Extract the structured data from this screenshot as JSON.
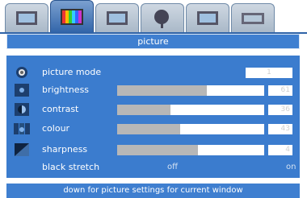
{
  "tabs": [
    {
      "icon": "tv-icon",
      "active": false
    },
    {
      "icon": "picture-tv-icon",
      "active": true
    },
    {
      "icon": "tv-sound-icon",
      "active": false
    },
    {
      "icon": "satellite-dish-icon",
      "active": false
    },
    {
      "icon": "tv-settings-icon",
      "active": false
    },
    {
      "icon": "tv-install-icon",
      "active": false
    }
  ],
  "title": "picture",
  "rows": {
    "picture_mode": {
      "label": "picture mode",
      "value": "1",
      "icon": "picture-mode-icon"
    },
    "brightness": {
      "label": "brightness",
      "value": "61",
      "level": 61,
      "icon": "brightness-icon"
    },
    "contrast": {
      "label": "contrast",
      "value": "36",
      "level": 36,
      "icon": "contrast-icon"
    },
    "colour": {
      "label": "colour",
      "value": "43",
      "level": 43,
      "icon": "colour-icon"
    },
    "sharpness": {
      "label": "sharpness",
      "value": "4",
      "level": 55,
      "icon": "sharpness-icon"
    },
    "black_stretch": {
      "label": "black stretch",
      "off": "off",
      "on": "on"
    }
  },
  "hint": "down for picture settings for current window",
  "colors": {
    "panel": "#3b7cce",
    "bar_fill": "#b7b7b7",
    "active_tab": "#2f63a8"
  }
}
